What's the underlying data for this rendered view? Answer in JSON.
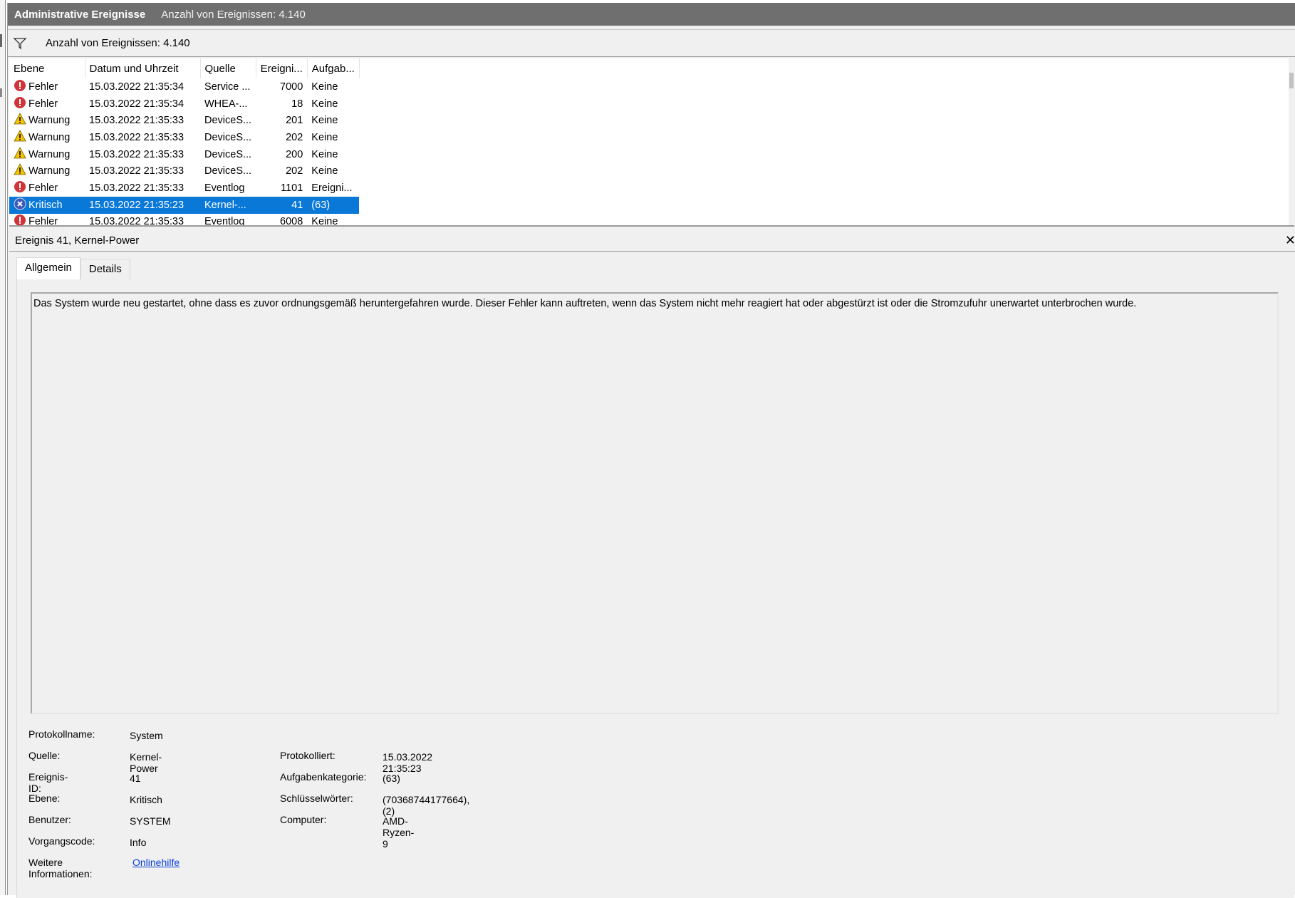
{
  "window": {
    "title": "Administrative Ereignisse",
    "count_text": "Anzahl von Ereignissen: 4.140"
  },
  "filter": {
    "text": "Anzahl von Ereignissen: 4.140"
  },
  "table": {
    "columns": [
      "Ebene",
      "Datum und Uhrzeit",
      "Quelle",
      "Ereigni...",
      "Aufgab..."
    ],
    "rows": [
      {
        "level": "Fehler",
        "icon": "error-icon",
        "date": "15.03.2022 21:35:34",
        "source": "Service ...",
        "id": "7000",
        "task": "Keine"
      },
      {
        "level": "Fehler",
        "icon": "error-icon",
        "date": "15.03.2022 21:35:34",
        "source": "WHEA-...",
        "id": "18",
        "task": "Keine"
      },
      {
        "level": "Warnung",
        "icon": "warning-icon",
        "date": "15.03.2022 21:35:33",
        "source": "DeviceS...",
        "id": "201",
        "task": "Keine"
      },
      {
        "level": "Warnung",
        "icon": "warning-icon",
        "date": "15.03.2022 21:35:33",
        "source": "DeviceS...",
        "id": "202",
        "task": "Keine"
      },
      {
        "level": "Warnung",
        "icon": "warning-icon",
        "date": "15.03.2022 21:35:33",
        "source": "DeviceS...",
        "id": "200",
        "task": "Keine"
      },
      {
        "level": "Warnung",
        "icon": "warning-icon",
        "date": "15.03.2022 21:35:33",
        "source": "DeviceS...",
        "id": "202",
        "task": "Keine"
      },
      {
        "level": "Fehler",
        "icon": "error-icon",
        "date": "15.03.2022 21:35:33",
        "source": "Eventlog",
        "id": "1101",
        "task": "Ereigni..."
      },
      {
        "level": "Kritisch",
        "icon": "critical-icon",
        "date": "15.03.2022 21:35:23",
        "source": "Kernel-...",
        "id": "41",
        "task": "(63)",
        "selected": true
      },
      {
        "level": "Fehler",
        "icon": "error-icon",
        "date": "15.03.2022 21:35:33",
        "source": "Eventlog",
        "id": "6008",
        "task": "Keine"
      }
    ]
  },
  "detail": {
    "title": "Ereignis 41, Kernel-Power",
    "close": "✕",
    "tabs": [
      "Allgemein",
      "Details"
    ],
    "description": "Das System wurde neu gestartet, ohne dass es zuvor ordnungsgemäß heruntergefahren wurde. Dieser Fehler kann auftreten, wenn das System nicht mehr reagiert hat oder abgestürzt ist oder die Stromzufuhr unerwartet unterbrochen wurde.",
    "props": {
      "protokollname_label": "Protokollname:",
      "protokollname": "System",
      "quelle_label": "Quelle:",
      "quelle": "Kernel-Power",
      "protokolliert_label": "Protokolliert:",
      "protokolliert": "15.03.2022 21:35:23",
      "ereignis_id_label": "Ereignis-ID:",
      "ereignis_id": "41",
      "aufgabenkategorie_label": "Aufgabenkategorie:",
      "aufgabenkategorie": "(63)",
      "ebene_label": "Ebene:",
      "ebene": "Kritisch",
      "schluesselwoerter_label": "Schlüsselwörter:",
      "schluesselwoerter": "(70368744177664),(2)",
      "benutzer_label": "Benutzer:",
      "benutzer": "SYSTEM",
      "computer_label": "Computer:",
      "computer": "AMD-Ryzen-9",
      "vorgangscode_label": "Vorgangscode:",
      "vorgangscode": "Info",
      "weitere_label": "Weitere Informationen:",
      "weitere_link": "Onlinehilfe"
    }
  },
  "colors": {
    "selection": "#0a78d7",
    "titlebar": "#6f6f6f",
    "error": "#d13438",
    "warning": "#f5c400",
    "critical": "#3b5bb5",
    "link": "#0a3fd9"
  }
}
